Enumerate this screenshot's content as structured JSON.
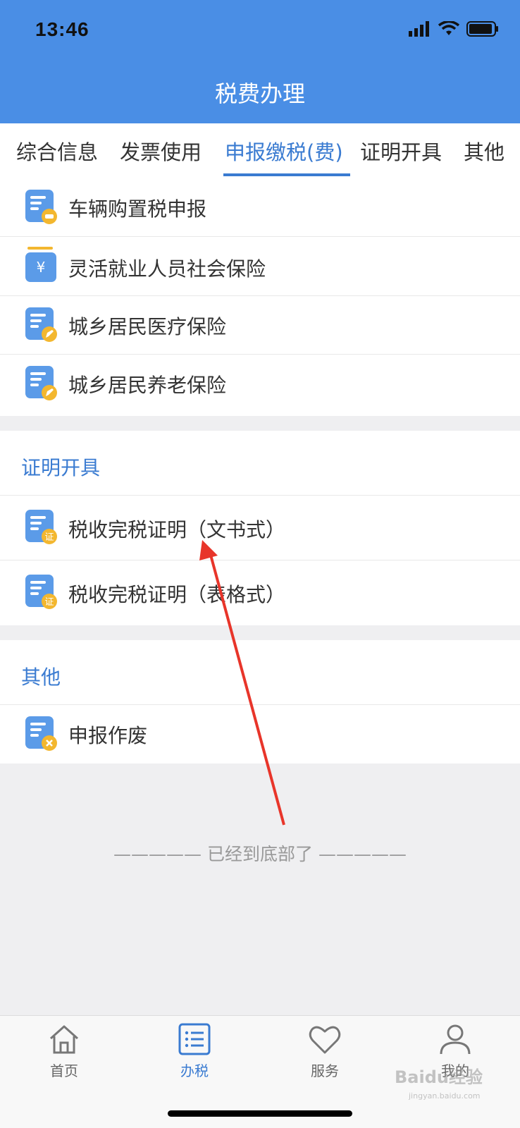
{
  "status_bar": {
    "time": "13:46"
  },
  "header": {
    "title": "税费办理"
  },
  "tabs": [
    {
      "label": "综合信息"
    },
    {
      "label": "发票使用"
    },
    {
      "label": "申报缴税(费)"
    },
    {
      "label": "证明开具"
    },
    {
      "label": "其他"
    }
  ],
  "active_tab": "申报缴税(费)",
  "declare_items": [
    {
      "label": "车辆购置税申报",
      "icon": "vehicle-doc-icon"
    },
    {
      "label": "灵活就业人员社会保险",
      "icon": "yuan-icon"
    },
    {
      "label": "城乡居民医疗保险",
      "icon": "doc-edit-icon"
    },
    {
      "label": "城乡居民养老保险",
      "icon": "doc-edit-icon"
    }
  ],
  "certificate_section": {
    "title": "证明开具",
    "items": [
      {
        "label": "税收完税证明（文书式）",
        "icon": "certificate-doc-icon",
        "badge": "证"
      },
      {
        "label": "税收完税证明（表格式）",
        "icon": "certificate-doc-icon",
        "badge": "证"
      }
    ]
  },
  "other_section": {
    "title": "其他",
    "items": [
      {
        "label": "申报作废",
        "icon": "doc-cancel-icon"
      }
    ]
  },
  "footer_text": "—————  已经到底部了  —————",
  "bottom_nav": [
    {
      "label": "首页",
      "icon": "home-icon"
    },
    {
      "label": "办税",
      "icon": "list-icon"
    },
    {
      "label": "服务",
      "icon": "heart-icon"
    },
    {
      "label": "我的",
      "icon": "user-icon"
    }
  ],
  "watermark": {
    "text": "Baidu经验",
    "sub": "jingyan.baidu.com"
  },
  "colors": {
    "header": "#4a8ee5",
    "accent": "#3a7bd1",
    "badge": "#f3b72f",
    "doc_icon": "#5b9be8",
    "arrow": "#e8352a"
  }
}
